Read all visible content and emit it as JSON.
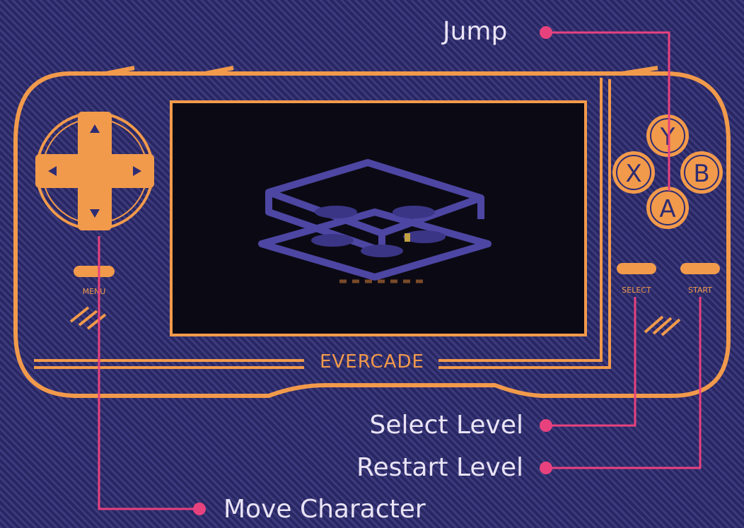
{
  "callouts": {
    "jump": "Jump",
    "select_level": "Select Level",
    "restart_level": "Restart Level",
    "move_character": "Move Character"
  },
  "device": {
    "brand": "EVERCADE",
    "menu_label": "MENU",
    "select_label": "SELECT",
    "start_label": "START",
    "buttons": {
      "y": "Y",
      "x": "X",
      "b": "B",
      "a": "A"
    }
  },
  "colors": {
    "background": "#2e2c72",
    "device_outline": "#f29a4b",
    "callout_line": "#e8427e",
    "callout_text": "#e9e3f5",
    "screen": "#0b0a14"
  },
  "icons": {
    "dpad": "dpad-icon",
    "callout_dot": "callout-dot-icon"
  }
}
